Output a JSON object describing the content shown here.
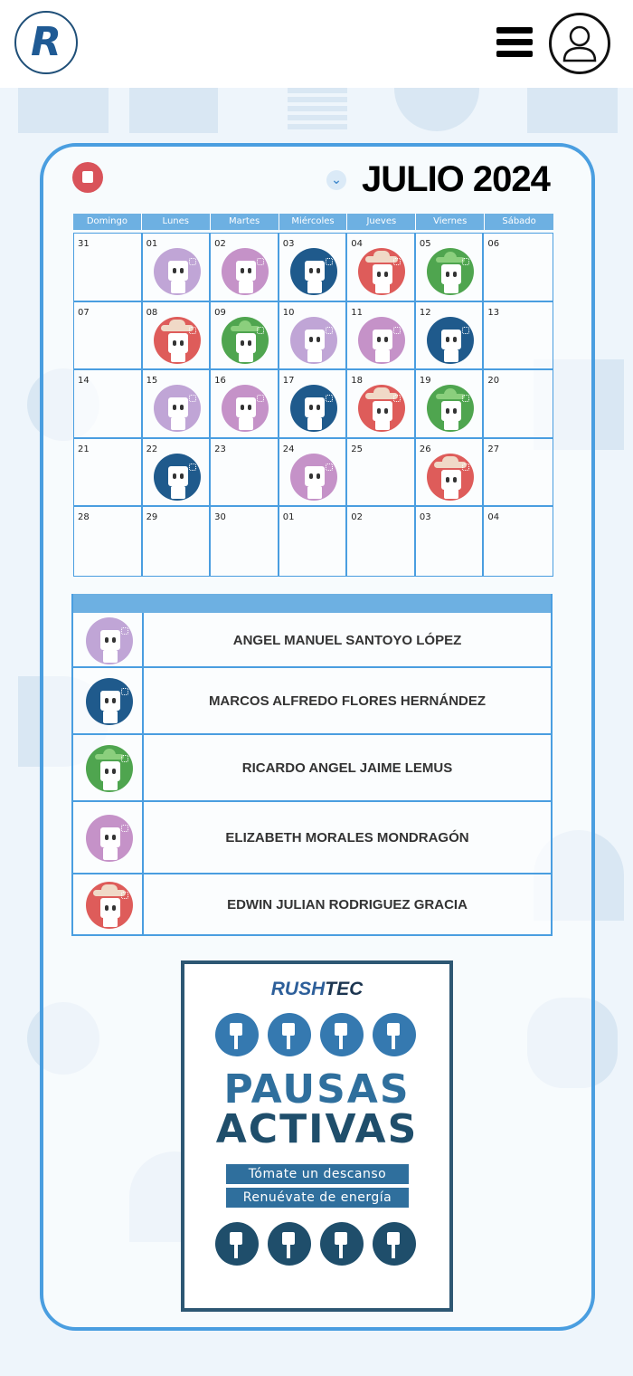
{
  "header": {
    "logo_letter": "R",
    "menu_icon": "hamburger-menu-icon",
    "user_icon": "user-profile-icon"
  },
  "calendar": {
    "month_title": "JULIO 2024",
    "weekdays": [
      "Domingo",
      "Lunes",
      "Martes",
      "Miércoles",
      "Jueves",
      "Viernes",
      "Sábado"
    ],
    "weeks": [
      [
        {
          "d": "31"
        },
        {
          "d": "01",
          "a": "lav"
        },
        {
          "d": "02",
          "a": "pink"
        },
        {
          "d": "03",
          "a": "blu"
        },
        {
          "d": "04",
          "a": "red"
        },
        {
          "d": "05",
          "a": "grn"
        },
        {
          "d": "06"
        }
      ],
      [
        {
          "d": "07"
        },
        {
          "d": "08",
          "a": "red"
        },
        {
          "d": "09",
          "a": "grn"
        },
        {
          "d": "10",
          "a": "lav"
        },
        {
          "d": "11",
          "a": "pink"
        },
        {
          "d": "12",
          "a": "blu"
        },
        {
          "d": "13"
        }
      ],
      [
        {
          "d": "14"
        },
        {
          "d": "15",
          "a": "lav"
        },
        {
          "d": "16",
          "a": "pink"
        },
        {
          "d": "17",
          "a": "blu"
        },
        {
          "d": "18",
          "a": "red"
        },
        {
          "d": "19",
          "a": "grn"
        },
        {
          "d": "20"
        }
      ],
      [
        {
          "d": "21"
        },
        {
          "d": "22",
          "a": "blu"
        },
        {
          "d": "23"
        },
        {
          "d": "24",
          "a": "pink"
        },
        {
          "d": "25"
        },
        {
          "d": "26",
          "a": "red"
        },
        {
          "d": "27"
        }
      ],
      [
        {
          "d": "28"
        },
        {
          "d": "29"
        },
        {
          "d": "30"
        },
        {
          "d": "01"
        },
        {
          "d": "02"
        },
        {
          "d": "03"
        },
        {
          "d": "04"
        }
      ]
    ]
  },
  "legend": [
    {
      "name": "ANGEL MANUEL SANTOYO LÓPEZ",
      "a": "lav"
    },
    {
      "name": "MARCOS ALFREDO FLORES HERNÁNDEZ",
      "a": "blu"
    },
    {
      "name": "RICARDO ANGEL JAIME LEMUS",
      "a": "grn"
    },
    {
      "name": "ELIZABETH MORALES MONDRAGÓN",
      "a": "pink"
    },
    {
      "name": "EDWIN JULIAN RODRIGUEZ GRACIA",
      "a": "red"
    }
  ],
  "poster": {
    "brand_a": "RUSH",
    "brand_b": "TEC",
    "title_1": "PAUSAS",
    "title_2": "ACTIVAS",
    "tag_1": "Tómate un descanso",
    "tag_2": "Renuévate de energía"
  },
  "colors": {
    "accent": "#4a9ee0",
    "header_blue": "#6db0e2",
    "lav": "#c0a5d6",
    "blu": "#1f5a8c",
    "red": "#de5c5a",
    "grn": "#4fa54f",
    "pink": "#c592c8"
  }
}
